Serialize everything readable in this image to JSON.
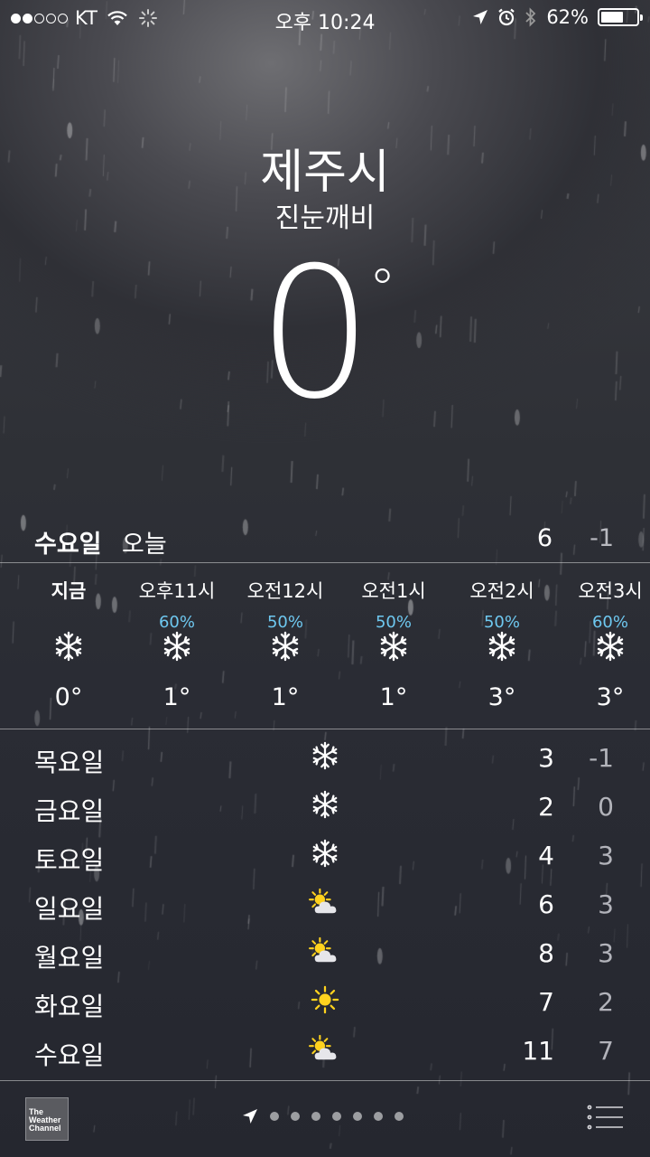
{
  "status_bar": {
    "carrier": "KT",
    "signal_bars_filled": 2,
    "signal_bars_total": 5,
    "time": "오후 10:24",
    "battery_percent": "62%",
    "battery_level": 0.62
  },
  "location": {
    "city": "제주시",
    "condition": "진눈깨비",
    "current_temp": "0",
    "degree_symbol": "°"
  },
  "today": {
    "day": "수요일",
    "label": "오늘",
    "high": "6",
    "low": "-1"
  },
  "hourly": [
    {
      "label": "지금",
      "pop": "",
      "icon": "snowflake-icon",
      "temp": "0°"
    },
    {
      "label": "오후11시",
      "pop": "60%",
      "icon": "snowflake-icon",
      "temp": "1°"
    },
    {
      "label": "오전12시",
      "pop": "50%",
      "icon": "snowflake-icon",
      "temp": "1°"
    },
    {
      "label": "오전1시",
      "pop": "50%",
      "icon": "snowflake-icon",
      "temp": "1°"
    },
    {
      "label": "오전2시",
      "pop": "50%",
      "icon": "snowflake-icon",
      "temp": "3°"
    },
    {
      "label": "오전3시",
      "pop": "60%",
      "icon": "snowflake-icon",
      "temp": "3°"
    }
  ],
  "daily": [
    {
      "day": "목요일",
      "icon": "snowflake-icon",
      "high": "3",
      "low": "-1"
    },
    {
      "day": "금요일",
      "icon": "snowflake-icon",
      "high": "2",
      "low": "0"
    },
    {
      "day": "토요일",
      "icon": "snowflake-icon",
      "high": "4",
      "low": "3"
    },
    {
      "day": "일요일",
      "icon": "partly-cloudy-icon",
      "high": "6",
      "low": "3"
    },
    {
      "day": "월요일",
      "icon": "partly-cloudy-icon",
      "high": "8",
      "low": "3"
    },
    {
      "day": "화요일",
      "icon": "sun-icon",
      "high": "7",
      "low": "2"
    },
    {
      "day": "수요일",
      "icon": "partly-cloudy-icon",
      "high": "11",
      "low": "7"
    }
  ],
  "footer": {
    "provider_logo_text": "The Weather Channel",
    "page_dots": 7,
    "current_page_is_location": true
  },
  "colors": {
    "precip_percent": "#6ec8f0",
    "sun": "#ffd21e",
    "cloud": "#e6e6ea"
  }
}
